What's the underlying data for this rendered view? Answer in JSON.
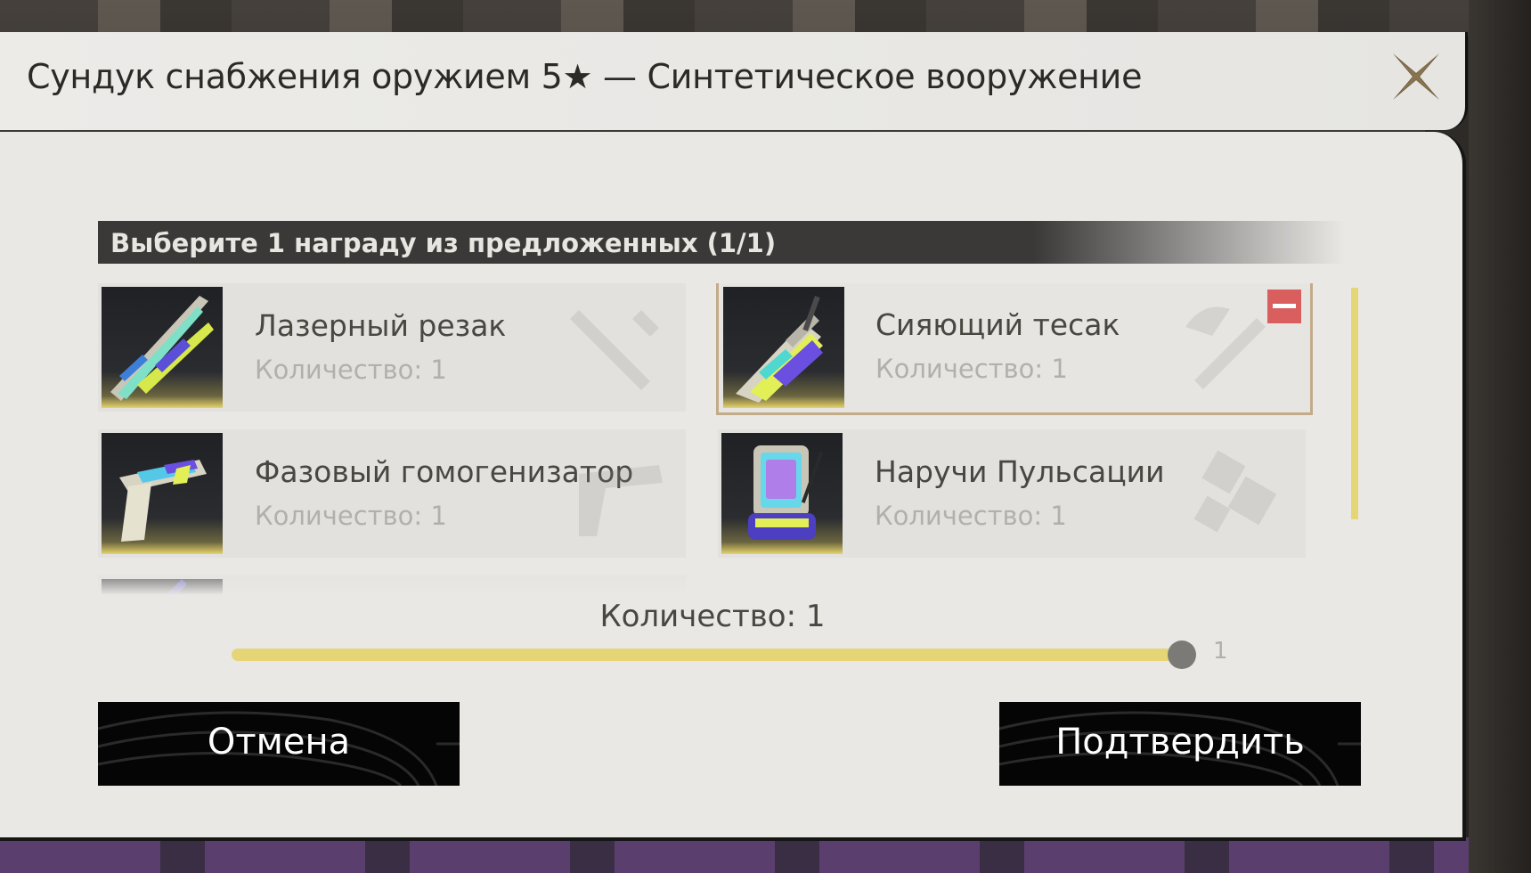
{
  "dialog": {
    "title": "Сундук снабжения оружием 5★ — Синтетическое вооружение",
    "close_icon": "close-x-icon"
  },
  "selection": {
    "prompt": "Выберите 1 награду из предложенных (1/1)"
  },
  "items": [
    {
      "name": "Лазерный резак",
      "quantity": "Количество: 1",
      "selected": false,
      "icon": "laser-cutter-weapon-icon"
    },
    {
      "name": "Сияющий тесак",
      "quantity": "Количество: 1",
      "selected": true,
      "icon": "radiant-cleaver-weapon-icon"
    },
    {
      "name": "Фазовый гомогенизатор",
      "quantity": "Количество: 1",
      "selected": false,
      "icon": "phase-homogenizer-weapon-icon"
    },
    {
      "name": "Наручи Пульсации",
      "quantity": "Количество: 1",
      "selected": false,
      "icon": "pulse-bracers-weapon-icon"
    }
  ],
  "quantity": {
    "label": "Количество: 1",
    "value": 1,
    "max": "1"
  },
  "buttons": {
    "cancel": "Отмена",
    "confirm": "Подтвердить"
  },
  "colors": {
    "accent_yellow": "#e5d577",
    "selected_border": "#c3ab88",
    "deselect_red": "#d95f5f",
    "button_bg": "#050505"
  }
}
